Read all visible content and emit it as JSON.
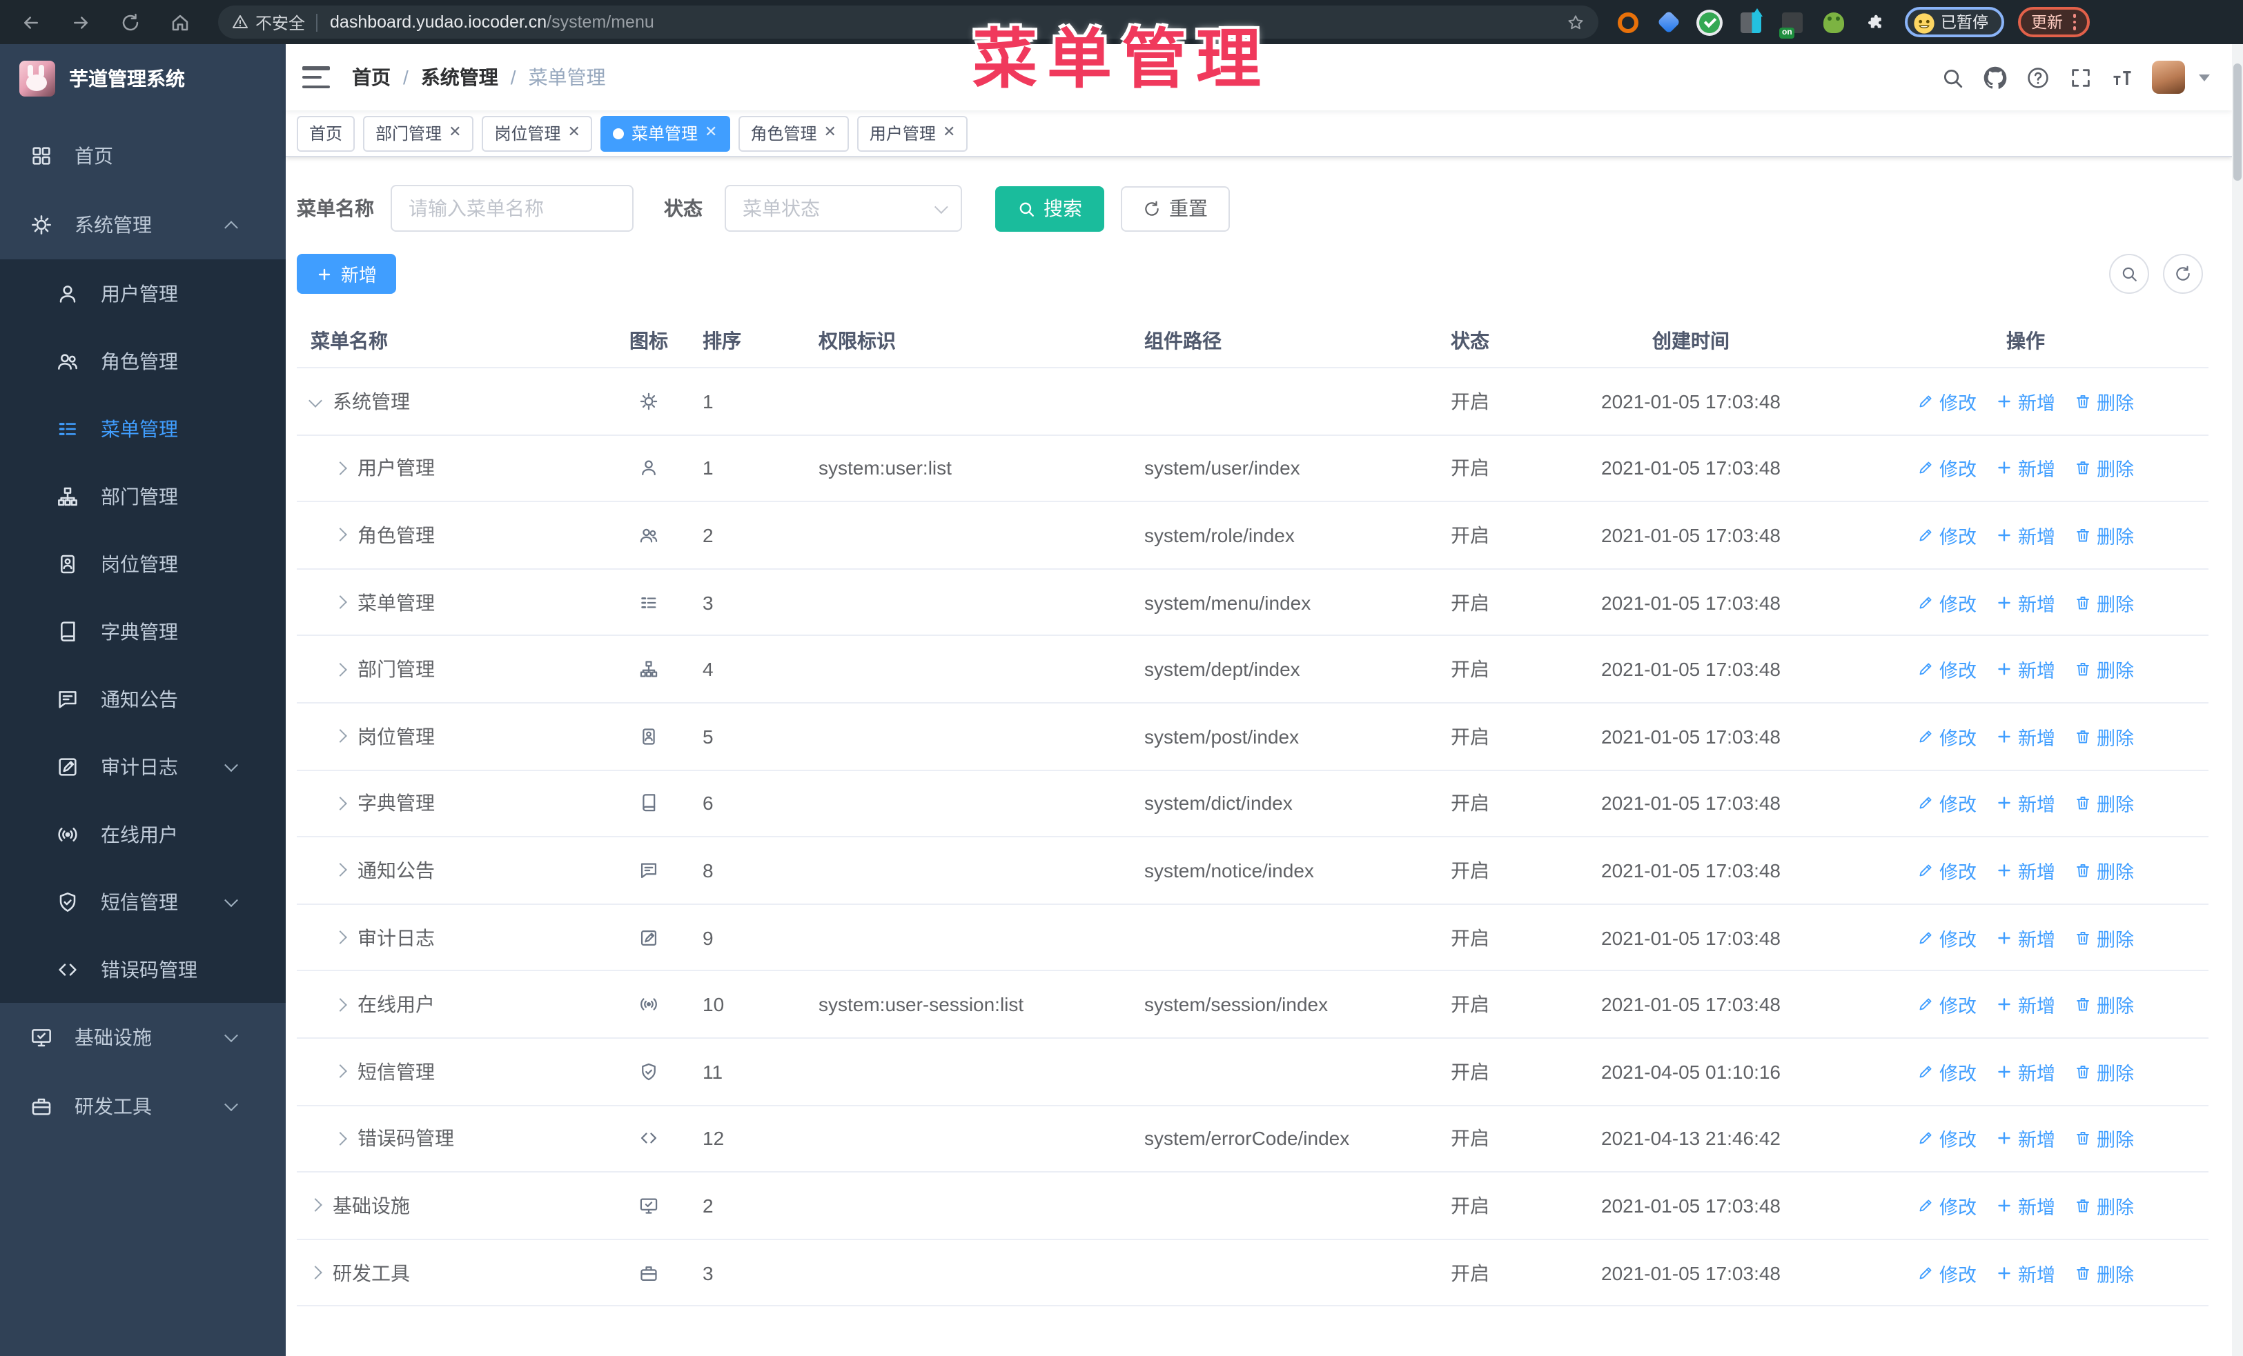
{
  "overlay_title": "菜单管理",
  "browser": {
    "security_label": "不安全",
    "url_host": "dashboard.yudao.iocoder.cn",
    "url_path": "/system/menu",
    "paused_label": "已暂停",
    "update_label": "更新"
  },
  "sidebar": {
    "app_title": "芋道管理系统",
    "items": [
      {
        "label": "首页",
        "icon": "home",
        "type": "root"
      },
      {
        "label": "系统管理",
        "icon": "gear",
        "type": "root",
        "chevron": "up"
      },
      {
        "label": "用户管理",
        "icon": "user",
        "type": "sub"
      },
      {
        "label": "角色管理",
        "icon": "users",
        "type": "sub"
      },
      {
        "label": "菜单管理",
        "icon": "menu",
        "type": "sub",
        "active": true
      },
      {
        "label": "部门管理",
        "icon": "tree",
        "type": "sub"
      },
      {
        "label": "岗位管理",
        "icon": "post",
        "type": "sub"
      },
      {
        "label": "字典管理",
        "icon": "dict",
        "type": "sub"
      },
      {
        "label": "通知公告",
        "icon": "notice",
        "type": "sub"
      },
      {
        "label": "审计日志",
        "icon": "log",
        "type": "sub",
        "chevron": "down"
      },
      {
        "label": "在线用户",
        "icon": "online",
        "type": "sub"
      },
      {
        "label": "短信管理",
        "icon": "sms",
        "type": "sub",
        "chevron": "down"
      },
      {
        "label": "错误码管理",
        "icon": "code",
        "type": "sub"
      },
      {
        "label": "基础设施",
        "icon": "infra",
        "type": "root",
        "chevron": "down"
      },
      {
        "label": "研发工具",
        "icon": "tool",
        "type": "root",
        "chevron": "down"
      }
    ]
  },
  "header": {
    "breadcrumb": [
      "首页",
      "系统管理",
      "菜单管理"
    ]
  },
  "tabs": [
    {
      "label": "首页",
      "closable": false,
      "active": false
    },
    {
      "label": "部门管理",
      "closable": true,
      "active": false
    },
    {
      "label": "岗位管理",
      "closable": true,
      "active": false
    },
    {
      "label": "菜单管理",
      "closable": true,
      "active": true
    },
    {
      "label": "角色管理",
      "closable": true,
      "active": false
    },
    {
      "label": "用户管理",
      "closable": true,
      "active": false
    }
  ],
  "filters": {
    "name_label": "菜单名称",
    "name_placeholder": "请输入菜单名称",
    "status_label": "状态",
    "status_placeholder": "菜单状态",
    "search_label": "搜索",
    "reset_label": "重置"
  },
  "toolbar": {
    "add_label": "新增"
  },
  "table": {
    "columns": [
      "菜单名称",
      "图标",
      "排序",
      "权限标识",
      "组件路径",
      "状态",
      "创建时间",
      "操作"
    ],
    "actions": [
      "修改",
      "新增",
      "删除"
    ],
    "rows": [
      {
        "name": "系统管理",
        "icon": "gear",
        "level": 0,
        "caret": "down",
        "order": "1",
        "perm": "",
        "path": "",
        "status": "开启",
        "created": "2021-01-05 17:03:48"
      },
      {
        "name": "用户管理",
        "icon": "user",
        "level": 1,
        "caret": "right",
        "order": "1",
        "perm": "system:user:list",
        "path": "system/user/index",
        "status": "开启",
        "created": "2021-01-05 17:03:48"
      },
      {
        "name": "角色管理",
        "icon": "users",
        "level": 1,
        "caret": "right",
        "order": "2",
        "perm": "",
        "path": "system/role/index",
        "status": "开启",
        "created": "2021-01-05 17:03:48"
      },
      {
        "name": "菜单管理",
        "icon": "menu",
        "level": 1,
        "caret": "right",
        "order": "3",
        "perm": "",
        "path": "system/menu/index",
        "status": "开启",
        "created": "2021-01-05 17:03:48"
      },
      {
        "name": "部门管理",
        "icon": "tree",
        "level": 1,
        "caret": "right",
        "order": "4",
        "perm": "",
        "path": "system/dept/index",
        "status": "开启",
        "created": "2021-01-05 17:03:48"
      },
      {
        "name": "岗位管理",
        "icon": "post",
        "level": 1,
        "caret": "right",
        "order": "5",
        "perm": "",
        "path": "system/post/index",
        "status": "开启",
        "created": "2021-01-05 17:03:48"
      },
      {
        "name": "字典管理",
        "icon": "dict",
        "level": 1,
        "caret": "right",
        "order": "6",
        "perm": "",
        "path": "system/dict/index",
        "status": "开启",
        "created": "2021-01-05 17:03:48"
      },
      {
        "name": "通知公告",
        "icon": "notice",
        "level": 1,
        "caret": "right",
        "order": "8",
        "perm": "",
        "path": "system/notice/index",
        "status": "开启",
        "created": "2021-01-05 17:03:48"
      },
      {
        "name": "审计日志",
        "icon": "log",
        "level": 1,
        "caret": "right",
        "order": "9",
        "perm": "",
        "path": "",
        "status": "开启",
        "created": "2021-01-05 17:03:48"
      },
      {
        "name": "在线用户",
        "icon": "online",
        "level": 1,
        "caret": "right",
        "order": "10",
        "perm": "system:user-session:list",
        "path": "system/session/index",
        "status": "开启",
        "created": "2021-01-05 17:03:48"
      },
      {
        "name": "短信管理",
        "icon": "sms",
        "level": 1,
        "caret": "right",
        "order": "11",
        "perm": "",
        "path": "",
        "status": "开启",
        "created": "2021-04-05 01:10:16"
      },
      {
        "name": "错误码管理",
        "icon": "code",
        "level": 1,
        "caret": "right",
        "order": "12",
        "perm": "",
        "path": "system/errorCode/index",
        "status": "开启",
        "created": "2021-04-13 21:46:42"
      },
      {
        "name": "基础设施",
        "icon": "infra",
        "level": 0,
        "caret": "right",
        "order": "2",
        "perm": "",
        "path": "",
        "status": "开启",
        "created": "2021-01-05 17:03:48"
      },
      {
        "name": "研发工具",
        "icon": "tool",
        "level": 0,
        "caret": "right",
        "order": "3",
        "perm": "",
        "path": "",
        "status": "开启",
        "created": "2021-01-05 17:03:48"
      }
    ]
  },
  "colors": {
    "accent": "#409EFF",
    "search_button": "#1ABC9C",
    "sidebar_bg": "#304156",
    "sidebar_sub_bg": "#1F2D3D",
    "annotation": "#F0395C"
  }
}
